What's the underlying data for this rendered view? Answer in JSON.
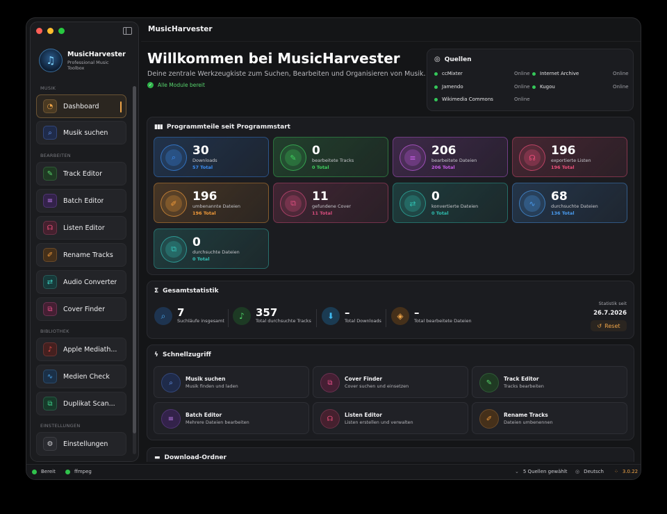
{
  "app": {
    "title": "MusicHarvester",
    "name": "MusicHarvester",
    "subtitle": "Professional Music Toolbox"
  },
  "sidebar": {
    "sections": {
      "musik": "MUSIK",
      "bearbeiten": "BEARBEITEN",
      "bibliothek": "BIBLIOTHEK",
      "einstellungen": "EINSTELLUNGEN"
    },
    "items": [
      {
        "label": "Dashboard"
      },
      {
        "label": "Musik suchen"
      },
      {
        "label": "Track Editor"
      },
      {
        "label": "Batch Editor"
      },
      {
        "label": "Listen Editor"
      },
      {
        "label": "Rename Tracks"
      },
      {
        "label": "Audio Converter"
      },
      {
        "label": "Cover Finder"
      },
      {
        "label": "Apple Mediath..."
      },
      {
        "label": "Medien Check"
      },
      {
        "label": "Duplikat Scan..."
      },
      {
        "label": "Einstellungen"
      }
    ]
  },
  "header": {
    "title": "Willkommen bei MusicHarvester",
    "subtitle": "Deine zentrale Werkzeugkiste zum Suchen, Bearbeiten und Organisieren von Musik.",
    "status": "Alle Module bereit"
  },
  "sources": {
    "title": "Quellen",
    "items": [
      {
        "name": "ccMixter",
        "status": "Online"
      },
      {
        "name": "Internet Archive",
        "status": "Online"
      },
      {
        "name": "Jamendo",
        "status": "Online"
      },
      {
        "name": "Kugou",
        "status": "Online"
      },
      {
        "name": "Wikimedia Commons",
        "status": "Online"
      }
    ]
  },
  "stats": {
    "title": "Programmteile seit Programmstart",
    "tiles": [
      {
        "value": "30",
        "caption": "Downloads",
        "total": "57 Total",
        "color": "#3b8ef5"
      },
      {
        "value": "0",
        "caption": "bearbeitete Tracks",
        "total": "0 Total",
        "color": "#3fcf5e"
      },
      {
        "value": "206",
        "caption": "bearbeitete Dateien",
        "total": "206 Total",
        "color": "#c85ee8"
      },
      {
        "value": "196",
        "caption": "exportierte Listen",
        "total": "196 Total",
        "color": "#ee4f7a"
      },
      {
        "value": "196",
        "caption": "umbenannte Dateien",
        "total": "196 Total",
        "color": "#f09a3a"
      },
      {
        "value": "11",
        "caption": "gefundene Cover",
        "total": "11 Total",
        "color": "#d94d7e"
      },
      {
        "value": "0",
        "caption": "konvertierte Dateien",
        "total": "0 Total",
        "color": "#2fbfb0"
      },
      {
        "value": "68",
        "caption": "durchsuchte Dateien",
        "total": "136 Total",
        "color": "#4a9cf0"
      },
      {
        "value": "0",
        "caption": "durchsuchte Dateien",
        "total": "0 Total",
        "color": "#35c2b8"
      }
    ]
  },
  "gesamt": {
    "title": "Gesamtstatistik",
    "items": [
      {
        "value": "7",
        "caption": "Suchläufe insgesamt"
      },
      {
        "value": "357",
        "caption": "Total durchsuchte Tracks"
      },
      {
        "value": "–",
        "caption": "Total Downloads"
      },
      {
        "value": "–",
        "caption": "Total bearbeitete Dateien"
      }
    ],
    "since_label": "Statistik seit",
    "since_date": "26.7.2026",
    "reset": "Reset"
  },
  "quick": {
    "title": "Schnellzugriff",
    "items": [
      {
        "title": "Musik suchen",
        "sub": "Musik finden und laden"
      },
      {
        "title": "Cover Finder",
        "sub": "Cover suchen und einsetzen"
      },
      {
        "title": "Track Editor",
        "sub": "Tracks bearbeiten"
      },
      {
        "title": "Batch Editor",
        "sub": "Mehrere Dateien bearbeiten"
      },
      {
        "title": "Listen Editor",
        "sub": "Listen erstellen und verwalten"
      },
      {
        "title": "Rename Tracks",
        "sub": "Dateien umbenennen"
      }
    ]
  },
  "download": {
    "title": "Download-Ordner"
  },
  "statusbar": {
    "ready": "Bereit",
    "ffmpeg": "ffmpeg",
    "sources": "5 Quellen gewählt",
    "language": "Deutsch",
    "version": "3.0.22"
  }
}
